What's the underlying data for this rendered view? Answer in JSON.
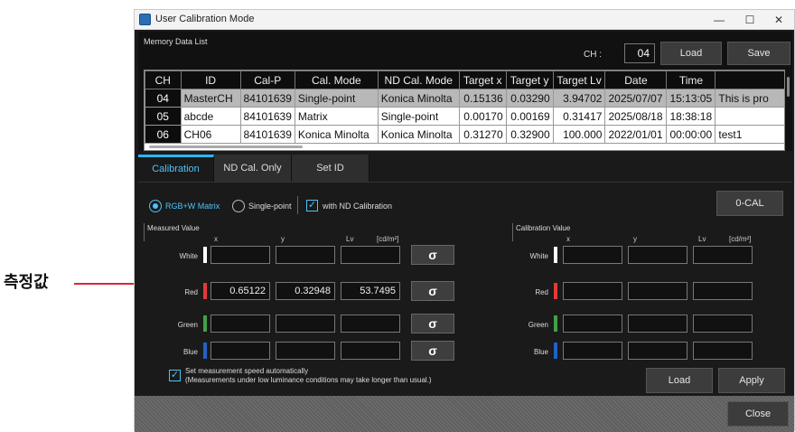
{
  "annotation": {
    "label": "측정값"
  },
  "window": {
    "title": "User Calibration Mode",
    "controls": {
      "minimize": "—",
      "maximize": "☐",
      "close": "✕"
    }
  },
  "memory": {
    "label": "Memory Data List",
    "ch_label": "CH :",
    "ch_value": "04",
    "load_label": "Load",
    "save_label": "Save",
    "columns": [
      "CH",
      "ID",
      "Cal-P",
      "Cal. Mode",
      "ND Cal. Mode",
      "Target x",
      "Target y",
      "Target Lv",
      "Date",
      "Time",
      ""
    ],
    "rows": [
      [
        "04",
        "MasterCH",
        "84101639",
        "Single-point",
        "Konica Minolta",
        "0.15136",
        "0.03290",
        "3.94702",
        "2025/07/07",
        "15:13:05",
        "This is pro"
      ],
      [
        "05",
        "abcde",
        "84101639",
        "Matrix",
        "Single-point",
        "0.00170",
        "0.00169",
        "0.31417",
        "2025/08/18",
        "18:38:18",
        ""
      ],
      [
        "06",
        "CH06",
        "84101639",
        "Konica Minolta",
        "Konica Minolta",
        "0.31270",
        "0.32900",
        "100.000",
        "2022/01/01",
        "00:00:00",
        "test1"
      ]
    ]
  },
  "tabs": [
    "Calibration",
    "ND Cal. Only",
    "Set ID"
  ],
  "calibration": {
    "mode_rgbw": "RGB+W Matrix",
    "mode_single": "Single-point",
    "with_nd": "with ND Calibration",
    "zero_cal": "0-CAL",
    "measured_title": "Measured Value",
    "calib_title": "Calibration Value",
    "headers": {
      "x": "x",
      "y": "y",
      "lv": "Lv",
      "unit": "[cd/m²]"
    },
    "rows": {
      "white": {
        "label": "White",
        "color": "#ffffff"
      },
      "red": {
        "label": "Red",
        "color": "#e53935",
        "x": "0.65122",
        "y": "0.32948",
        "lv": "53.7495"
      },
      "green": {
        "label": "Green",
        "color": "#43a047"
      },
      "blue": {
        "label": "Blue",
        "color": "#1e63c7"
      }
    },
    "measure_icon": "σ",
    "auto_speed_line1": "Set measurement speed automatically",
    "auto_speed_line2": "(Measurements under low luminance conditions may take longer than usual.)",
    "load_label": "Load",
    "apply_label": "Apply"
  },
  "footer": {
    "close_label": "Close"
  }
}
